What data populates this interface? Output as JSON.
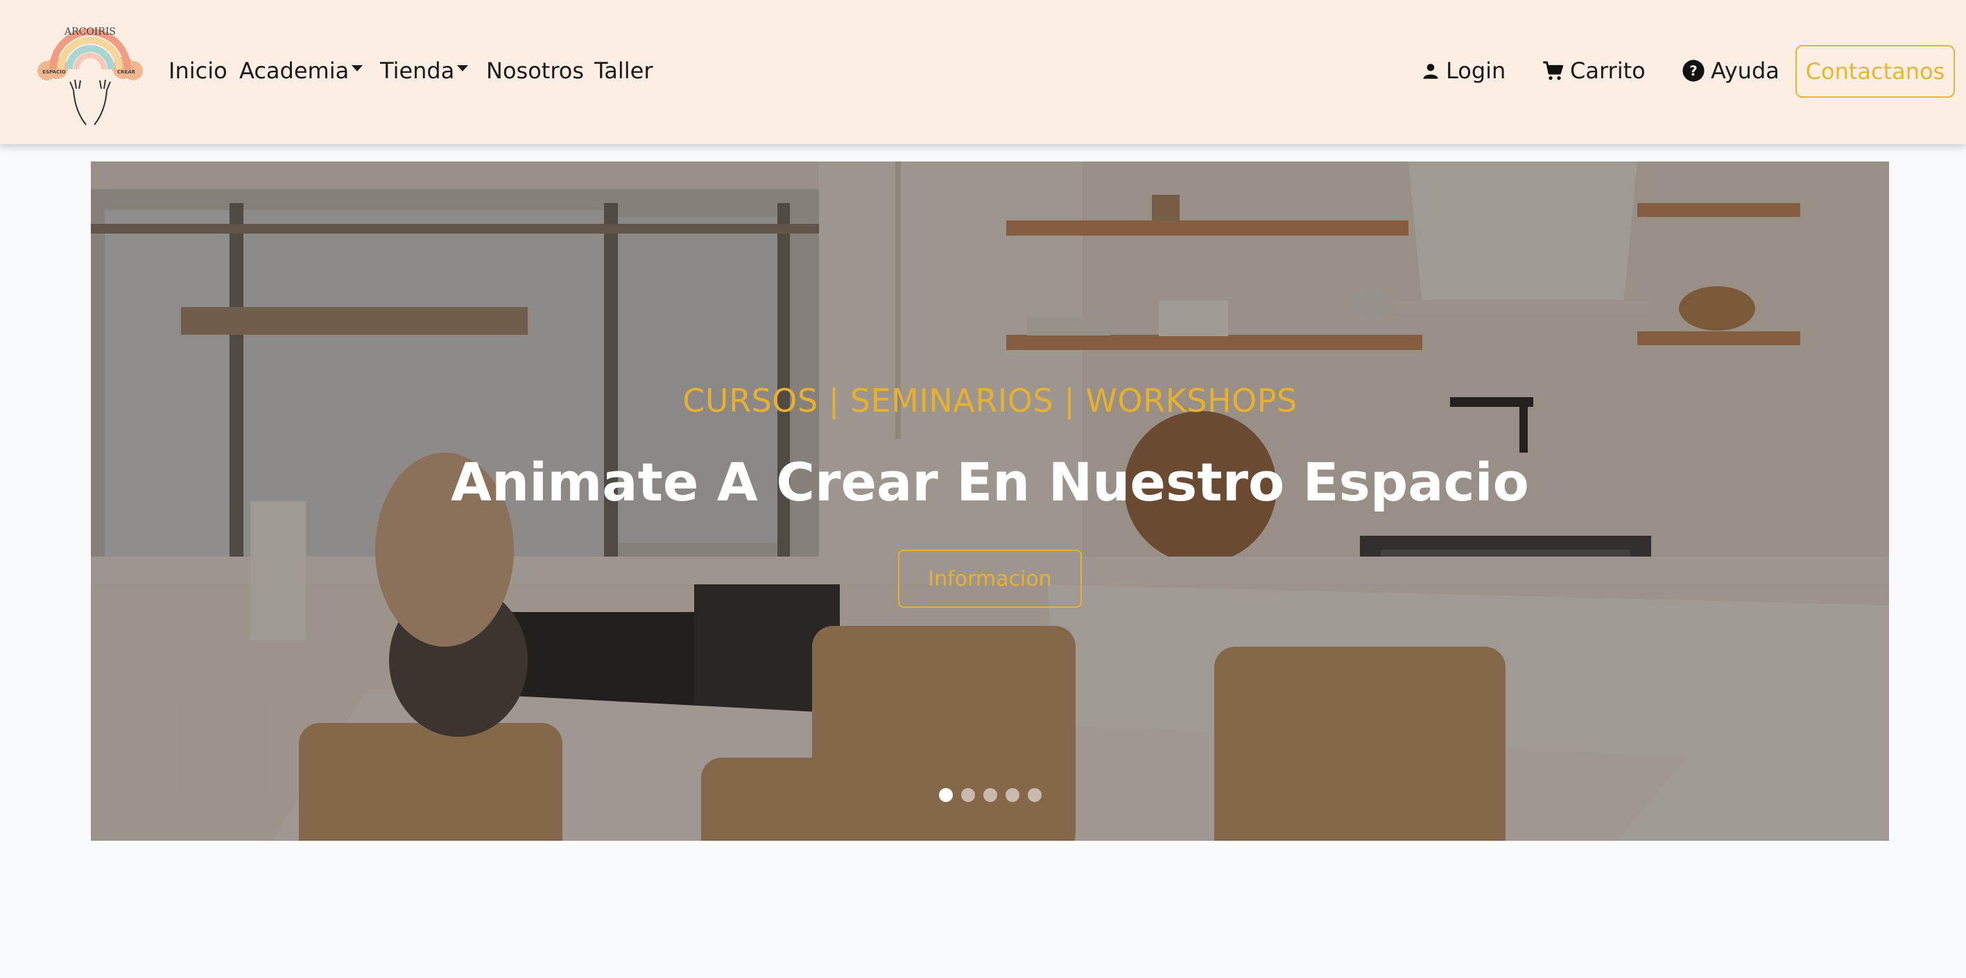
{
  "brand": {
    "logo_text_top": "ARCOIRIS",
    "logo_text_left": "ESPACIO",
    "logo_text_right": "CREAR"
  },
  "nav": {
    "inicio": "Inicio",
    "academia": "Academia",
    "tienda": "Tienda",
    "nosotros": "Nosotros",
    "taller": "Taller",
    "login": "Login",
    "carrito": "Carrito",
    "ayuda": "Ayuda",
    "contactanos": "Contactanos"
  },
  "icons": {
    "login": "user-icon",
    "carrito": "cart-icon",
    "ayuda": "help-circle-icon",
    "dropdown": "caret-down-icon"
  },
  "hero": {
    "subtitle": "CURSOS | SEMINARIOS | WORKSHOPS",
    "title": "Animate A Crear En Nuestro Espacio",
    "button": "Informacion",
    "slide_count": 5,
    "active_slide": 1
  },
  "colors": {
    "navbar_bg": "#fdeee3",
    "accent": "#e5b534",
    "page_bg": "#f8f9fb",
    "text": "#1b1b1b"
  }
}
